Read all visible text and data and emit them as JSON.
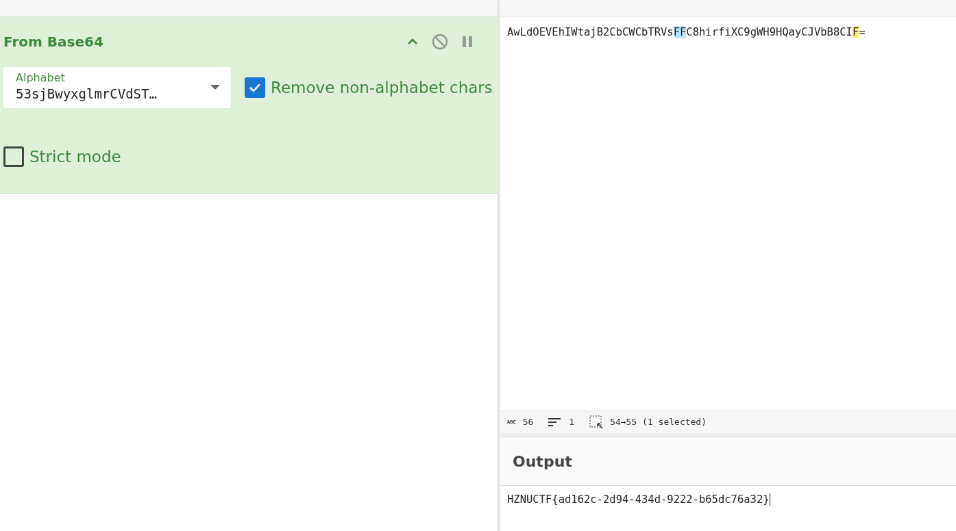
{
  "recipe": {
    "operation": {
      "title": "From Base64",
      "disabled": false,
      "paused": false,
      "alphabet": {
        "label": "Alphabet",
        "value": "53sjBwyxglmrCVdST…"
      },
      "options": [
        {
          "label": "Remove non-alphabet chars",
          "checked": true
        },
        {
          "label": "Strict mode",
          "checked": false
        }
      ]
    }
  },
  "input": {
    "segments": [
      {
        "text": "AwLdOEVEhIWtajB2CbCWCbTRVs",
        "kind": "plain"
      },
      {
        "text": "FF",
        "kind": "match"
      },
      {
        "text": "C8hirfiXC9gWH9HQayCJVbB8CI",
        "kind": "plain"
      },
      {
        "text": "F",
        "kind": "selection"
      },
      {
        "text": "=",
        "kind": "plain"
      }
    ],
    "status_bar": {
      "length_label": "ABC",
      "length": "56",
      "lines": "1",
      "selection": "54→55 (1 selected)"
    }
  },
  "output": {
    "title": "Output",
    "text": "HZNUCTF{ad162c-2d94-434d-9222-b65dc76a32}"
  }
}
